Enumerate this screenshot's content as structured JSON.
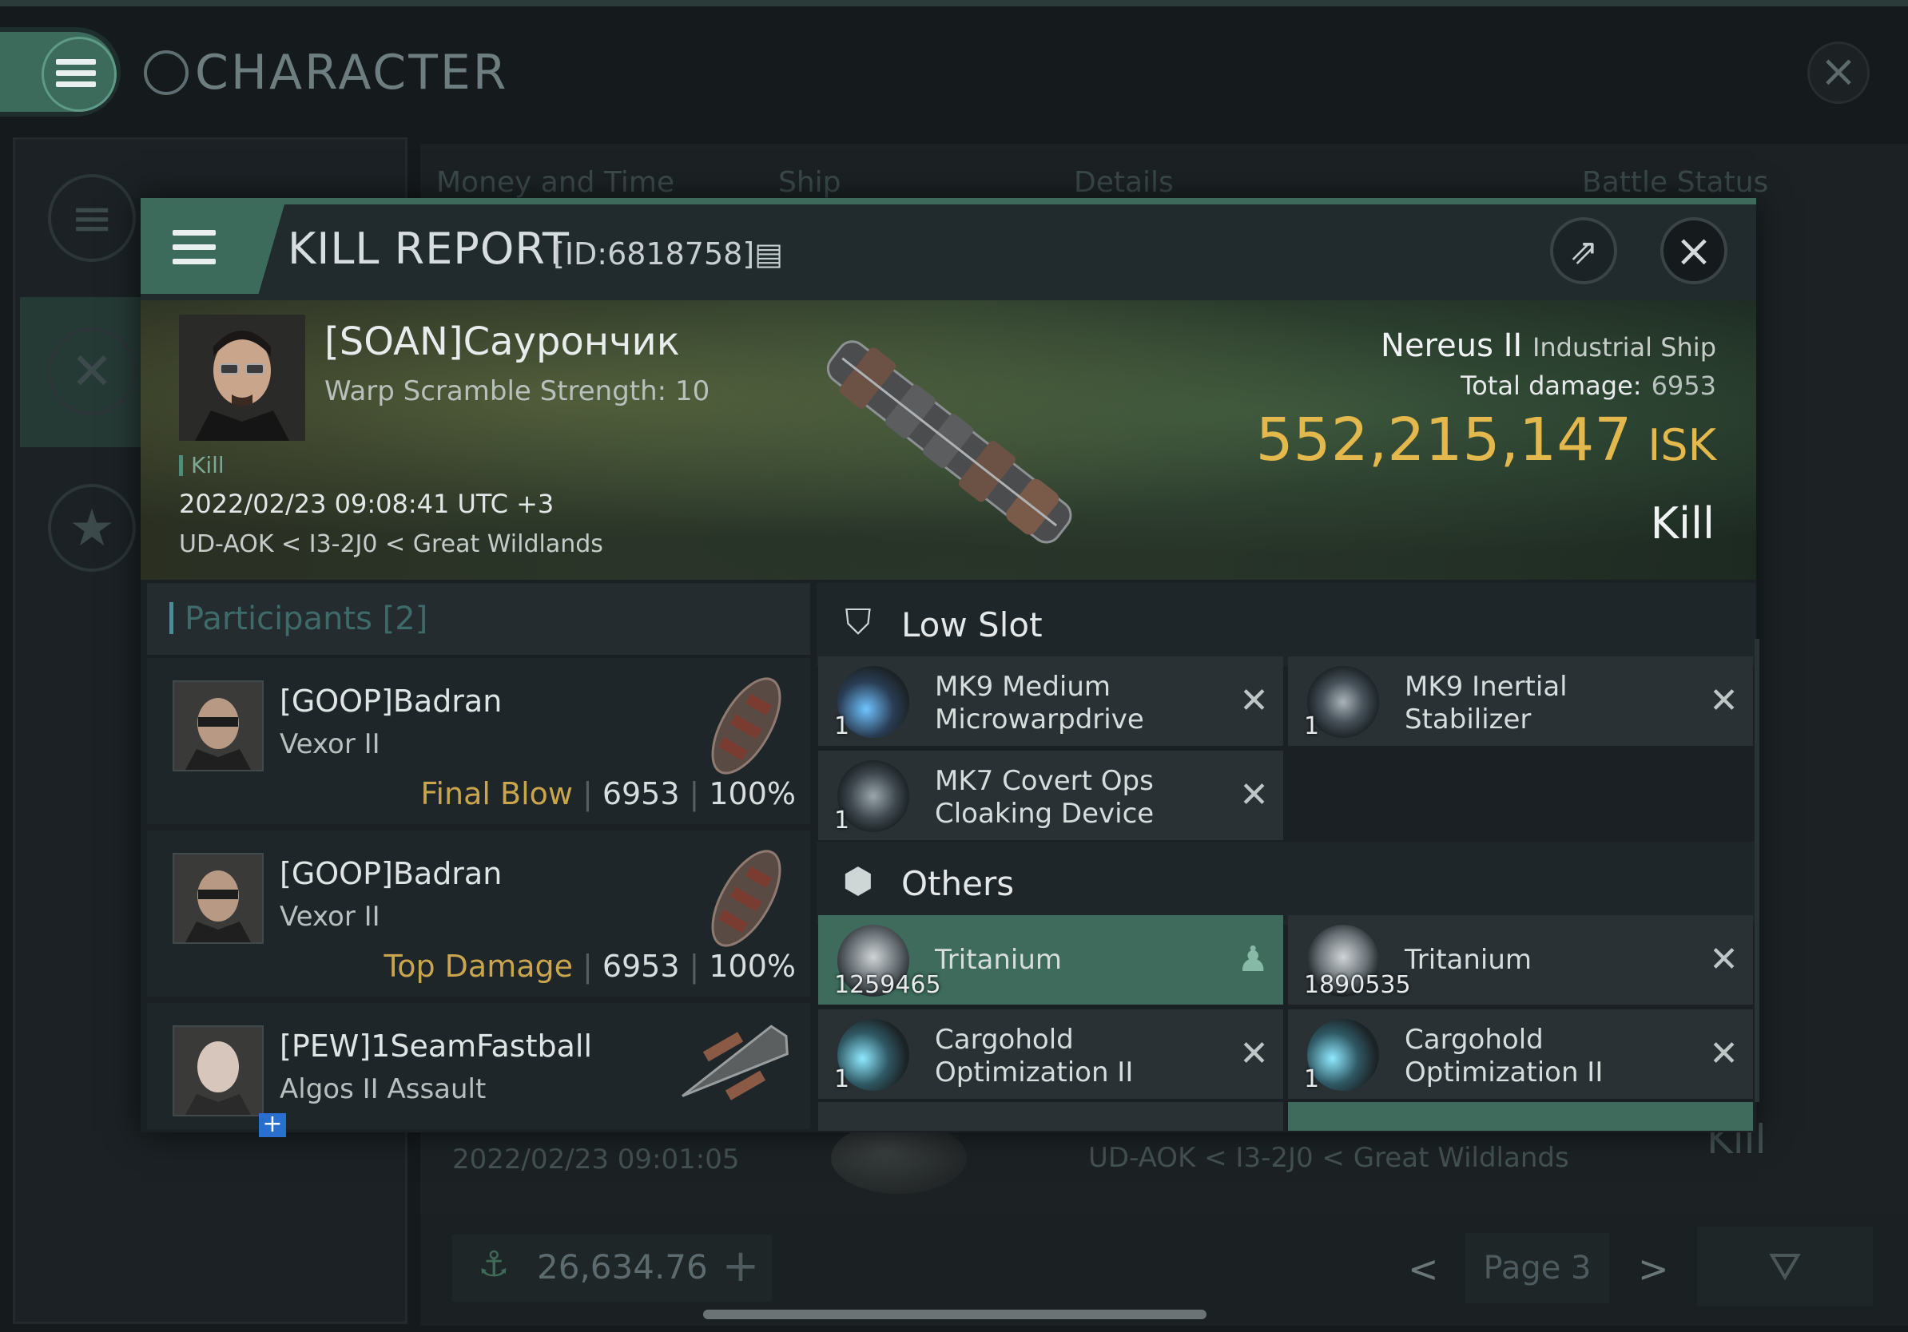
{
  "background": {
    "window_title": "CHARACTER",
    "tabs": [
      "Money and Time",
      "Ship",
      "Details",
      "Battle Status"
    ],
    "entry": {
      "date": "2022/02/23  09:01:05",
      "location": "UD-AOK < I3-2J0 < Great Wildlands",
      "result": "Kill"
    },
    "wallet_amount": "26,634.76",
    "page_label": "Page 3"
  },
  "kill_report": {
    "title": "KILL REPORT",
    "id_label": "[ID:6818758]",
    "victim": {
      "name": "[SOAN]Саурончик",
      "warp_scramble": "Warp Scramble Strength: 10",
      "kill_tag": "Kill",
      "datetime": "2022/02/23 09:08:41 UTC +3",
      "location": "UD-AOK < I3-2J0 < Great Wildlands",
      "ship": "Nereus II",
      "ship_class": "Industrial Ship",
      "total_damage_label": "Total damage:",
      "total_damage": "6953",
      "isk_value": "552,215,147",
      "isk_unit": "ISK",
      "result": "Kill"
    },
    "participants": {
      "title": "Participants [2]",
      "rows": [
        {
          "name": "[GOOP]Badran",
          "ship": "Vexor II",
          "tag": "Final Blow",
          "damage": "6953",
          "percent": "100%"
        },
        {
          "name": "[GOOP]Badran",
          "ship": "Vexor II",
          "tag": "Top Damage",
          "damage": "6953",
          "percent": "100%"
        },
        {
          "name": "[PEW]1SeamFastball",
          "ship": "Algos II Assault"
        }
      ]
    },
    "low_slot": {
      "title": "Low Slot",
      "items": [
        {
          "qty": "1",
          "label": "MK9 Medium\nMicrowarpdrive"
        },
        {
          "qty": "1",
          "label": "MK9 Inertial\nStabilizer"
        },
        {
          "qty": "1",
          "label": "MK7 Covert Ops\nCloaking Device"
        }
      ]
    },
    "others": {
      "title": "Others",
      "items": [
        {
          "qty": "1259465",
          "label": "Tritanium"
        },
        {
          "qty": "1890535",
          "label": "Tritanium"
        },
        {
          "qty": "1",
          "label": "Cargohold\nOptimization II"
        },
        {
          "qty": "1",
          "label": "Cargohold\nOptimization II"
        }
      ]
    }
  }
}
